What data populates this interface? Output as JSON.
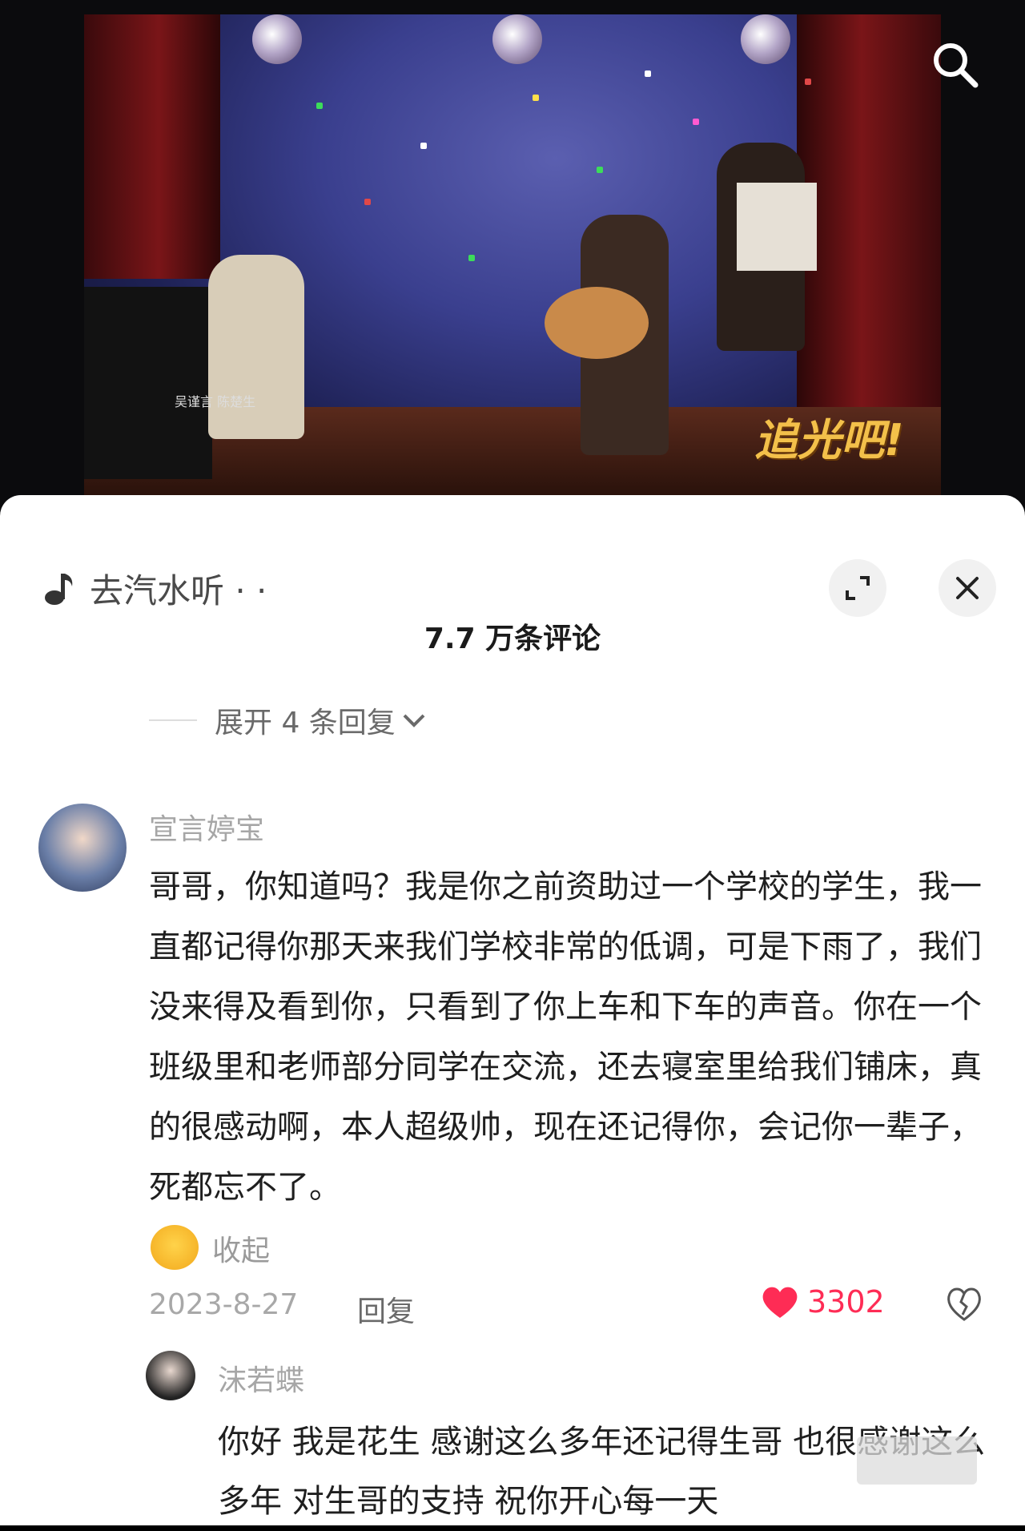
{
  "video": {
    "caption": "吴谨言 陈楚生",
    "show_logo": "追光吧!",
    "search_icon": "search-icon"
  },
  "sheet": {
    "music_label": "去汽水听 · ·",
    "music_icon": "music-note-icon",
    "expand_icon": "expand-icon",
    "close_icon": "close-icon",
    "title": "7.7 万条评论",
    "expand_replies": "展开 4 条回复"
  },
  "comment": {
    "username": "宣言婷宝",
    "text": "哥哥，你知道吗？我是你之前资助过一个学校的学生，我一直都记得你那天来我们学校非常的低调，可是下雨了，我们没来得及看到你，只看到了你上车和下车的声音。你在一个班级里和老师部分同学在交流，还去寝室里给我们铺床，真的很感动啊，本人超级帅，现在还记得你，会记你一辈子，死都忘不了。",
    "collapse_label": "收起",
    "date": "2023-8-27",
    "reply_label": "回复",
    "like_count": "3302"
  },
  "reply": {
    "username": "沫若蝶",
    "text": "你好 我是花生 感谢这么多年还记得生哥 也很感谢这么多年 对生哥的支持 祝你开心每一天"
  },
  "colors": {
    "like": "#fe2c55",
    "muted": "#a6a6a6"
  }
}
